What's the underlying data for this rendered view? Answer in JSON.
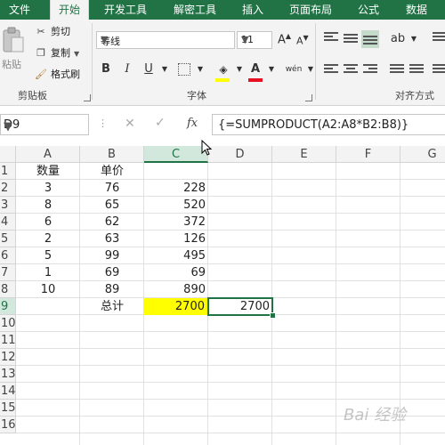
{
  "tabs": [
    "文件",
    "开始",
    "开发工具",
    "解密工具",
    "插入",
    "页面布局",
    "公式",
    "数据"
  ],
  "clipboard": {
    "paste_label": "粘贴",
    "cut_label": "剪切",
    "copy_label": "复制",
    "format_painter_label": "格式刷",
    "group_label": "剪贴板"
  },
  "font": {
    "name": "等线",
    "size": "11",
    "grow_label": "A",
    "shrink_label": "A",
    "bold_label": "B",
    "italic_label": "I",
    "underline_label": "U",
    "font_color_label": "A",
    "phonetic_label": "wén",
    "group_label": "字体",
    "fill_color": "#ffff00",
    "font_color": "#e81123"
  },
  "alignment": {
    "group_label": "对齐方式"
  },
  "formula_bar": {
    "name_box": "D9",
    "fx_label": "fx",
    "formula": "{=SUMPRODUCT(A2:A8*B2:B8)}"
  },
  "sheet": {
    "columns": [
      "A",
      "B",
      "C",
      "D",
      "E",
      "F",
      "G"
    ],
    "rows": [
      "1",
      "2",
      "3",
      "4",
      "5",
      "6",
      "7",
      "8",
      "9",
      "10",
      "11",
      "12",
      "13",
      "14",
      "15",
      "16"
    ],
    "selected_column": "C",
    "header_row": {
      "a": "数量",
      "b": "单价"
    },
    "data_rows": [
      {
        "a": "3",
        "b": "76",
        "c": "228"
      },
      {
        "a": "8",
        "b": "65",
        "c": "520"
      },
      {
        "a": "6",
        "b": "62",
        "c": "372"
      },
      {
        "a": "2",
        "b": "63",
        "c": "126"
      },
      {
        "a": "5",
        "b": "99",
        "c": "495"
      },
      {
        "a": "1",
        "b": "69",
        "c": "69"
      },
      {
        "a": "10",
        "b": "89",
        "c": "890"
      }
    ],
    "total_row": {
      "b": "总计",
      "c": "2700",
      "d": "2700"
    },
    "highlight_color": "#ffff00",
    "accent_color": "#217346"
  },
  "watermark": "Bai 经验"
}
